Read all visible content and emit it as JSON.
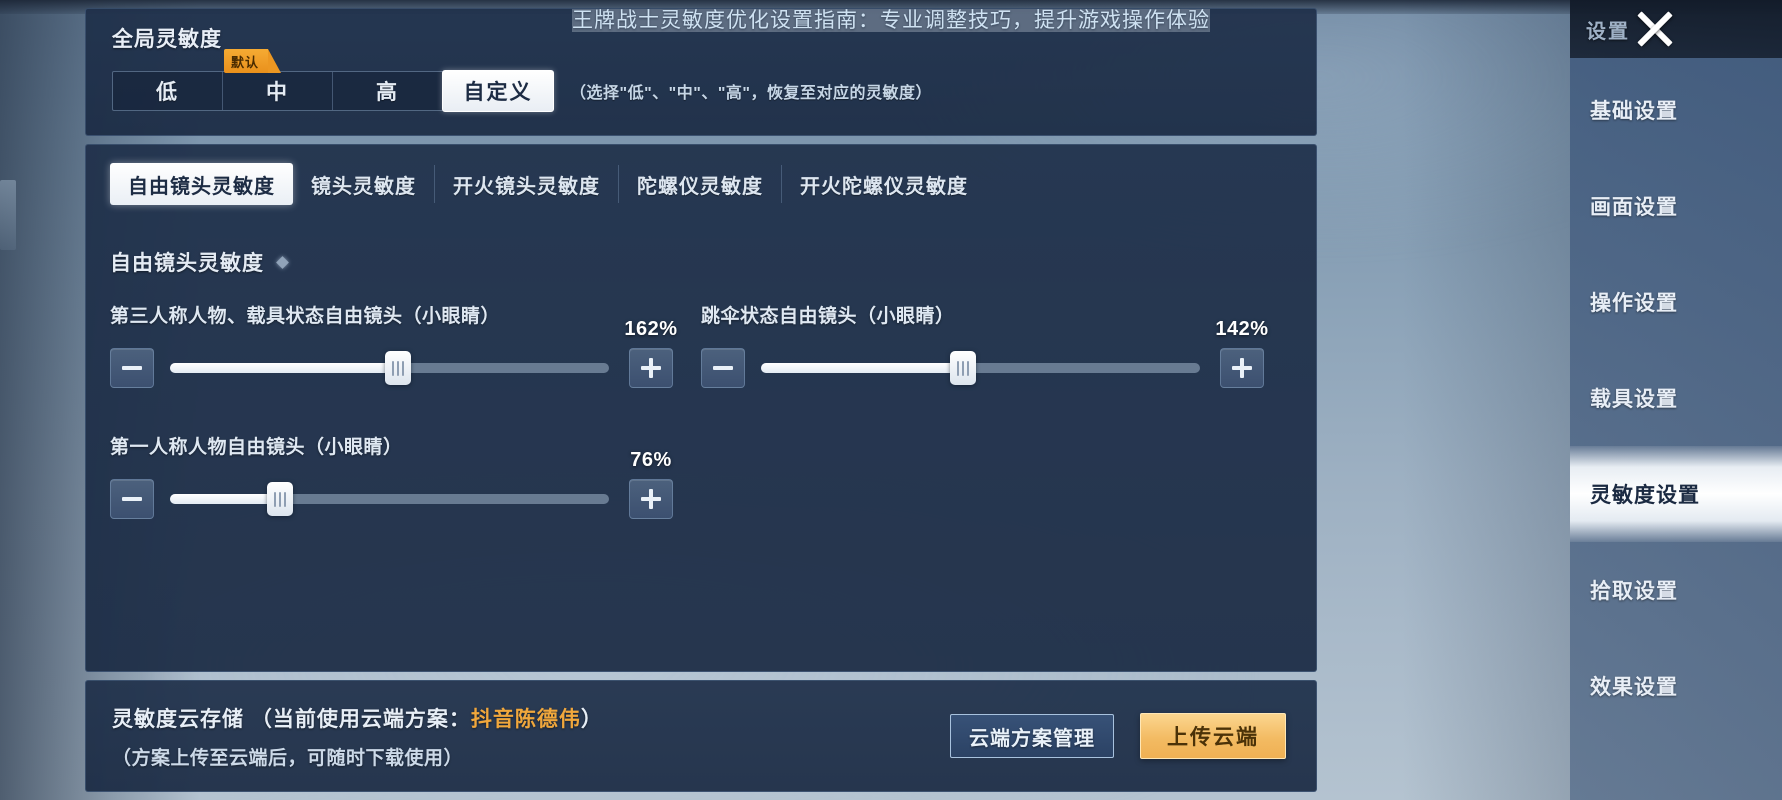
{
  "watermark": {
    "text": "王牌战士灵敏度优化设置指南：专业调整技巧，提升游戏操作体验"
  },
  "global_sensitivity": {
    "title": "全局灵敏度",
    "default_badge": "默认",
    "options": [
      {
        "label": "低",
        "active": false
      },
      {
        "label": "中",
        "active": false
      },
      {
        "label": "高",
        "active": false
      },
      {
        "label": "自定义",
        "active": true
      }
    ],
    "hint": "（选择\"低\"、\"中\"、\"高\"，恢复至对应的灵敏度）"
  },
  "tabs": [
    {
      "label": "自由镜头灵敏度",
      "active": true
    },
    {
      "label": "镜头灵敏度",
      "active": false
    },
    {
      "label": "开火镜头灵敏度",
      "active": false
    },
    {
      "label": "陀螺仪灵敏度",
      "active": false
    },
    {
      "label": "开火陀螺仪灵敏度",
      "active": false
    }
  ],
  "section": {
    "title": "自由镜头灵敏度"
  },
  "sliders": [
    {
      "label": "第三人称人物、载具状态自由镜头（小眼睛）",
      "value": "162%",
      "percent": 52,
      "minus": "−",
      "plus": "+"
    },
    {
      "label": "跳伞状态自由镜头（小眼睛）",
      "value": "142%",
      "percent": 46,
      "minus": "−",
      "plus": "+"
    },
    {
      "label": "第一人称人物自由镜头（小眼睛）",
      "value": "76%",
      "percent": 25,
      "minus": "−",
      "plus": "+"
    }
  ],
  "cloud": {
    "line1_prefix": "灵敏度云存储 （当前使用云端方案：",
    "scheme_name": "抖音陈德伟",
    "line1_suffix": "）",
    "line2": "（方案上传至云端后，可随时下载使用）",
    "manage_button": "云端方案管理",
    "upload_button": "上传云端"
  },
  "sidebar": {
    "title": "设置",
    "close_icon": "close-icon",
    "items": [
      {
        "label": "基础设置",
        "active": false
      },
      {
        "label": "画面设置",
        "active": false
      },
      {
        "label": "操作设置",
        "active": false
      },
      {
        "label": "载具设置",
        "active": false
      },
      {
        "label": "灵敏度设置",
        "active": true
      },
      {
        "label": "拾取设置",
        "active": false
      },
      {
        "label": "效果设置",
        "active": false
      }
    ]
  },
  "colors": {
    "accent_gold": "#efb053",
    "panel_bg": "#1f304a",
    "active_white": "#ffffff",
    "sidebar_bg": "#4e6686"
  }
}
